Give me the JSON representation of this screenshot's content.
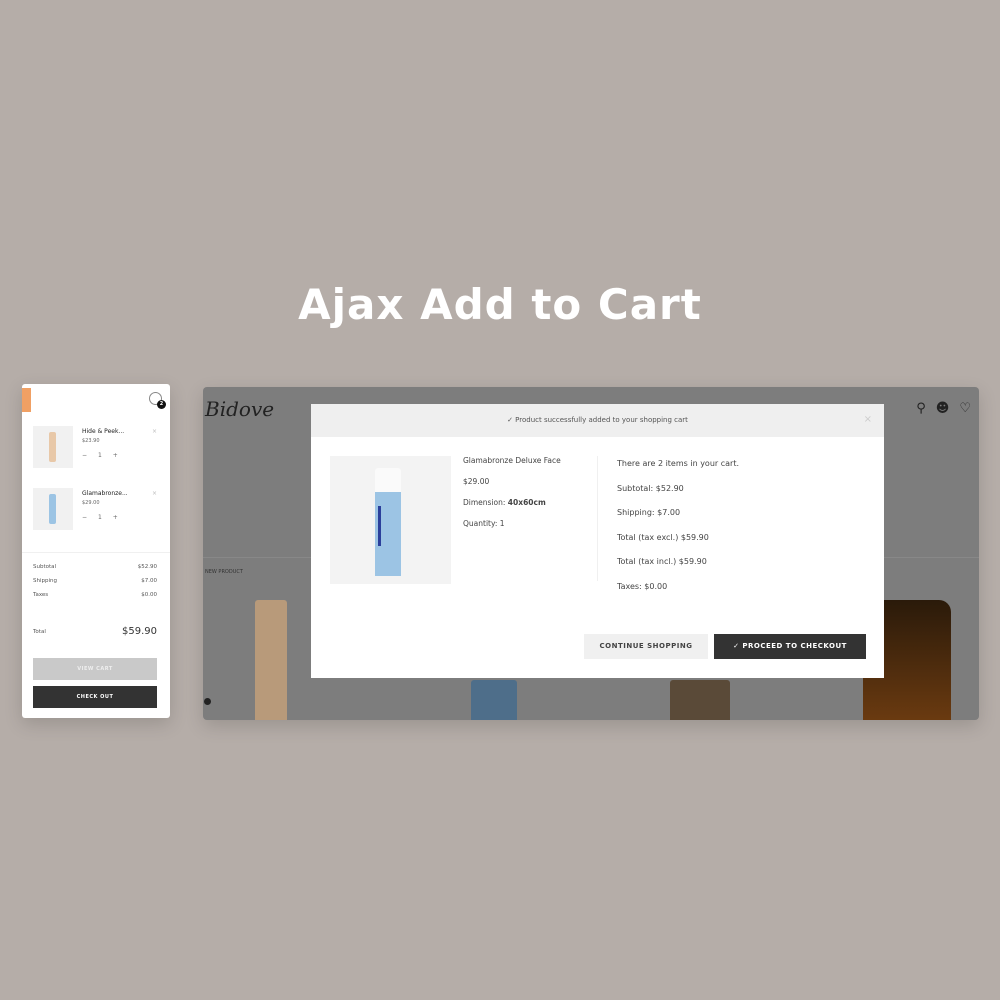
{
  "title": "Ajax Add to Cart",
  "mini_cart": {
    "badge": "2",
    "items": [
      {
        "name": "Hide & Peek...",
        "price": "$23.90",
        "qty": "1",
        "minus": "−",
        "plus": "+",
        "remove": "×"
      },
      {
        "name": "Glamabronze...",
        "price": "$29.00",
        "qty": "1",
        "minus": "−",
        "plus": "+",
        "remove": "×"
      }
    ],
    "subtotal_label": "Subtotal",
    "subtotal": "$52.90",
    "shipping_label": "Shipping",
    "shipping": "$7.00",
    "taxes_label": "Taxes",
    "taxes": "$0.00",
    "total_label": "Total",
    "total": "$59.90",
    "view_cart": "VIEW CART",
    "checkout": "CHECK OUT"
  },
  "site": {
    "logo": "Bidove",
    "new_product": "NEW PRODUCT",
    "icons": [
      "search-icon",
      "user-icon",
      "cart-icon"
    ]
  },
  "modal": {
    "message": "✓ Product successfully added to your shopping cart",
    "close": "×",
    "product": {
      "name": "Glamabronze Deluxe Face",
      "price": "$29.00",
      "dimension_label": "Dimension:",
      "dimension": "40x60cm",
      "quantity": "Quantity: 1"
    },
    "cart": {
      "count_text": "There are 2 items in your cart.",
      "subtotal": "Subtotal: $52.90",
      "shipping": "Shipping: $7.00",
      "total_excl": "Total (tax excl.) $59.90",
      "total_incl": "Total (tax incl.) $59.90",
      "taxes": "Taxes: $0.00"
    },
    "continue": "CONTINUE SHOPPING",
    "proceed": "✓  PROCEED TO CHECKOUT"
  },
  "colors": {
    "background": "#b5ada8",
    "accent": "#f0a064",
    "dark_button": "#333333"
  }
}
